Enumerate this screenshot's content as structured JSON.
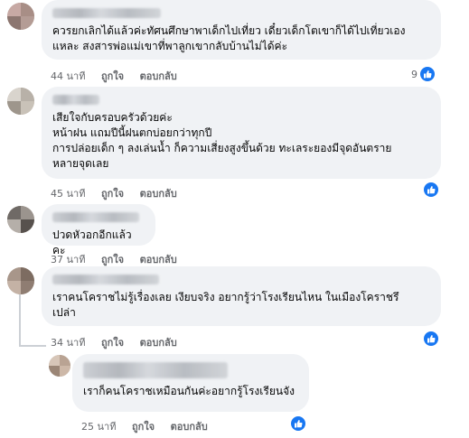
{
  "comments": [
    {
      "text": "ควรยกเลิกได้แล้วค่ะทัศนศึกษาพาเด็กไปเที่ยว เดี๋ยวเด็กโตเขาก็ได้ไปเที่ยวเอง\nแหละ สงสารพ่อแม่เขาที่พาลูกเขากลับบ้านไม่ได้ค่ะ",
      "time": "44 นาที",
      "like_label": "ถูกใจ",
      "reply_label": "ตอบกลับ",
      "reaction_count": "9",
      "reaction_icon": "like-icon"
    },
    {
      "text": "เสียใจกับครอบครัวด้วยค่ะ\nหน้าฝน แถมปีนี้ฝนตกบ่อยกว่าทุกปี\nการปล่อยเด็ก ๆ ลงเล่นน้ำ ก็ความเสี่ยงสูงขึ้นด้วย ทะเลระยองมีจุดอันตราย\nหลายจุดเลย",
      "time": "45 นาที",
      "like_label": "ถูกใจ",
      "reply_label": "ตอบกลับ",
      "reaction_count": "",
      "reaction_icon": "like-icon"
    },
    {
      "text": "ปวดหัวอกอีกแล้วคะ",
      "time": "37 นาที",
      "like_label": "ถูกใจ",
      "reply_label": "ตอบกลับ",
      "reaction_count": ""
    },
    {
      "text": "เราคนโคราชไม่รู้เรื่องเลย เงียบจริง อยากรู้ว่าโรงเรียนไหน ในเมืองโคราชรึ\nเปล่า",
      "time": "34 นาที",
      "like_label": "ถูกใจ",
      "reply_label": "ตอบกลับ",
      "reaction_count": "",
      "reaction_icon": "like-icon"
    },
    {
      "text": "เราก็คนโคราชเหมือนกันค่ะอยากรู้โรงเรียนจัง",
      "time": "25 นาที",
      "like_label": "ถูกใจ",
      "reply_label": "ตอบกลับ",
      "reaction_count": "",
      "reaction_icon": "like-icon"
    }
  ],
  "colors": {
    "bubble": "#f0f2f5",
    "meta_text": "#65676b",
    "like_blue": "#1877f2",
    "thread_line": "#ccd0d5"
  }
}
